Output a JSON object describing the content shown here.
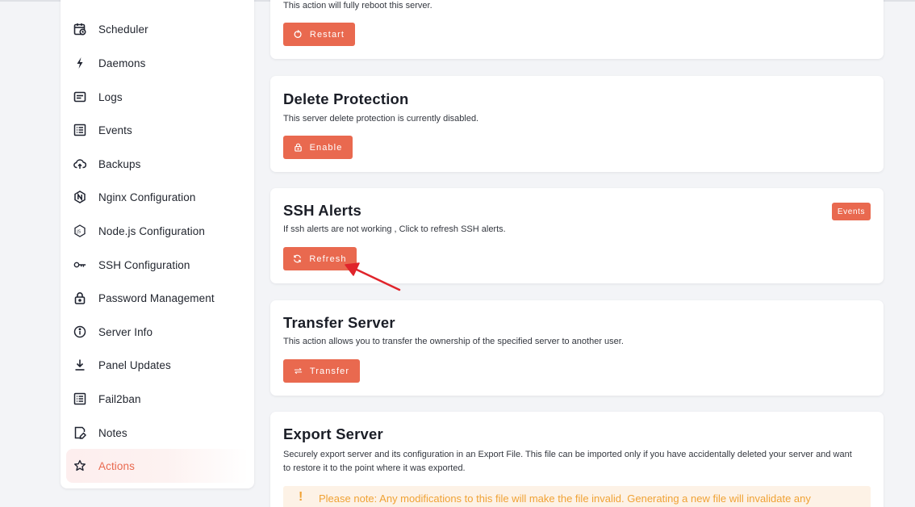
{
  "sidebar": {
    "items": [
      {
        "label": "Scheduler",
        "icon": "calendar-clock-icon"
      },
      {
        "label": "Daemons",
        "icon": "lightning-icon"
      },
      {
        "label": "Logs",
        "icon": "log-lines-icon"
      },
      {
        "label": "Events",
        "icon": "list-icon"
      },
      {
        "label": "Backups",
        "icon": "cloud-upload-icon"
      },
      {
        "label": "Nginx Configuration",
        "icon": "nginx-icon"
      },
      {
        "label": "Node.js Configuration",
        "icon": "nodejs-icon"
      },
      {
        "label": "SSH Configuration",
        "icon": "key-icon"
      },
      {
        "label": "Password Management",
        "icon": "lock-icon"
      },
      {
        "label": "Server Info",
        "icon": "info-icon"
      },
      {
        "label": "Panel Updates",
        "icon": "download-icon"
      },
      {
        "label": "Fail2ban",
        "icon": "list-icon"
      },
      {
        "label": "Notes",
        "icon": "note-edit-icon"
      },
      {
        "label": "Actions",
        "icon": "star-icon",
        "active": true
      }
    ]
  },
  "cards": {
    "restart": {
      "description": "This action will fully reboot this server.",
      "button": "Restart"
    },
    "delete_protection": {
      "title": "Delete Protection",
      "description": "This server delete protection is currently disabled.",
      "button": "Enable"
    },
    "ssh_alerts": {
      "title": "SSH Alerts",
      "description": "If ssh alerts are not working , Click to refresh SSH alerts.",
      "button": "Refresh",
      "badge": "Events"
    },
    "transfer": {
      "title": "Transfer Server",
      "description": "This action allows you to transfer the ownership of the specified server to another user.",
      "button": "Transfer"
    },
    "export": {
      "title": "Export Server",
      "description_line1": "Securely export server and its configuration in an Export File. This file can be imported only if you have accidentally deleted your server and want",
      "description_line2": "to restore it to the point where it was exported.",
      "note": "Please note: Any modifications to this file will make the file invalid. Generating a new file will invalidate any"
    }
  },
  "colors": {
    "accent": "#e9694f",
    "annotation_arrow": "#e0242b",
    "warning_text": "#f0a234",
    "warning_bg": "#fdf2e6"
  }
}
